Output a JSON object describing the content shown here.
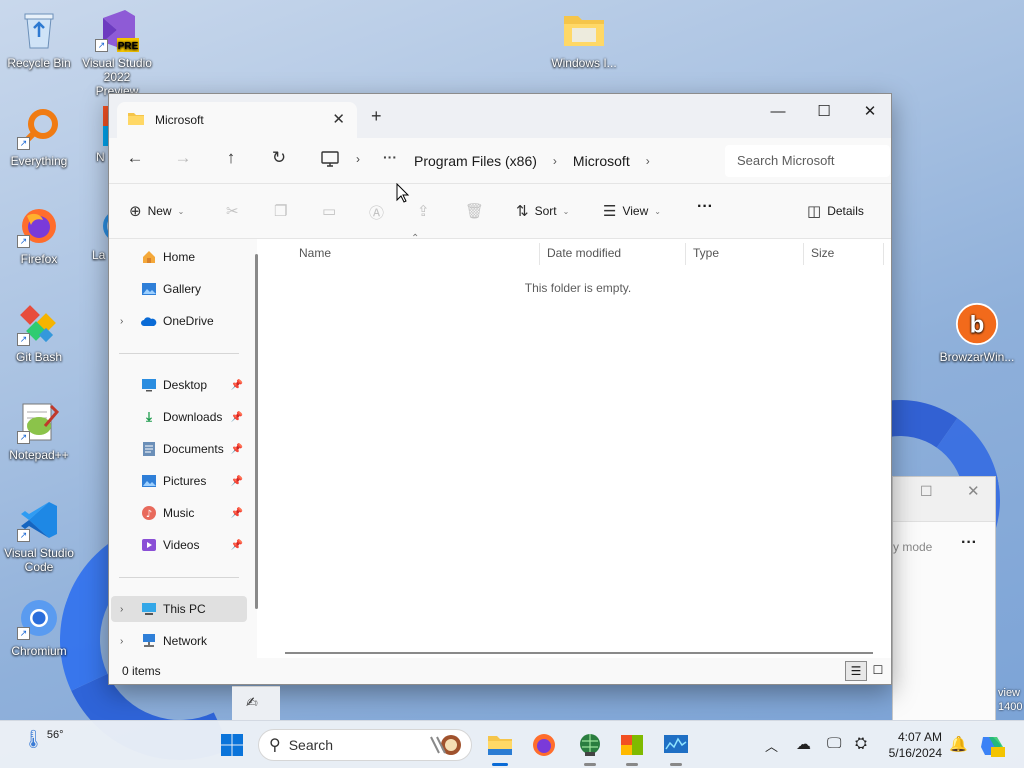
{
  "desktop": {
    "icons": [
      {
        "name": "recycle-bin-icon",
        "label": "Recycle Bin"
      },
      {
        "name": "visual-studio-preview-icon",
        "label": "Visual Studio 2022 Preview",
        "badge": "PRE"
      },
      {
        "name": "everything-icon",
        "label": "Everything"
      },
      {
        "name": "firefox-icon",
        "label": "Firefox"
      },
      {
        "name": "git-bash-icon",
        "label": "Git Bash"
      },
      {
        "name": "notepad-plus-plus-icon",
        "label": "Notepad++"
      },
      {
        "name": "vscode-icon",
        "label": "Visual Studio Code"
      },
      {
        "name": "chromium-icon",
        "label": "Chromium"
      },
      {
        "name": "windows-folder-icon",
        "label": "Windows I..."
      },
      {
        "name": "browzar-icon",
        "label": "BrowzarWin..."
      },
      {
        "name": "partial-icon-n",
        "label": "N"
      },
      {
        "name": "partial-icon-la",
        "label": "La"
      }
    ]
  },
  "explorer": {
    "tab_title": "Microsoft",
    "new_tab": "+",
    "breadcrumbs": [
      "Program Files (x86)",
      "Microsoft"
    ],
    "search_placeholder": "Search Microsoft",
    "commands": {
      "new": "New",
      "sort": "Sort",
      "view": "View",
      "more": "···",
      "details": "Details"
    },
    "sidebar": {
      "top": [
        {
          "label": "Home",
          "icon": "home-icon"
        },
        {
          "label": "Gallery",
          "icon": "gallery-icon"
        },
        {
          "label": "OneDrive",
          "icon": "onedrive-icon"
        }
      ],
      "quick_access": [
        {
          "label": "Desktop",
          "icon": "desktop-icon"
        },
        {
          "label": "Downloads",
          "icon": "downloads-icon"
        },
        {
          "label": "Documents",
          "icon": "documents-icon"
        },
        {
          "label": "Pictures",
          "icon": "pictures-icon"
        },
        {
          "label": "Music",
          "icon": "music-icon"
        },
        {
          "label": "Videos",
          "icon": "videos-icon"
        }
      ],
      "bottom": [
        {
          "label": "This PC",
          "icon": "this-pc-icon"
        },
        {
          "label": "Network",
          "icon": "network-icon"
        }
      ]
    },
    "columns": [
      "Name",
      "Date modified",
      "Type",
      "Size"
    ],
    "empty_message": "This folder is empty.",
    "status": "0 items"
  },
  "background_window": {
    "partial_label": "y mode",
    "more": "···",
    "partial_view_text": "view",
    "partial_build_text": "1400"
  },
  "taskbar": {
    "weather_temp": "56°",
    "search_label": "Search",
    "time": "4:07 AM",
    "date": "5/16/2024"
  },
  "colors": {
    "accent": "#0067c0",
    "folder_yellow": "#f7c948",
    "selected_bg": "#e0e0e0"
  }
}
